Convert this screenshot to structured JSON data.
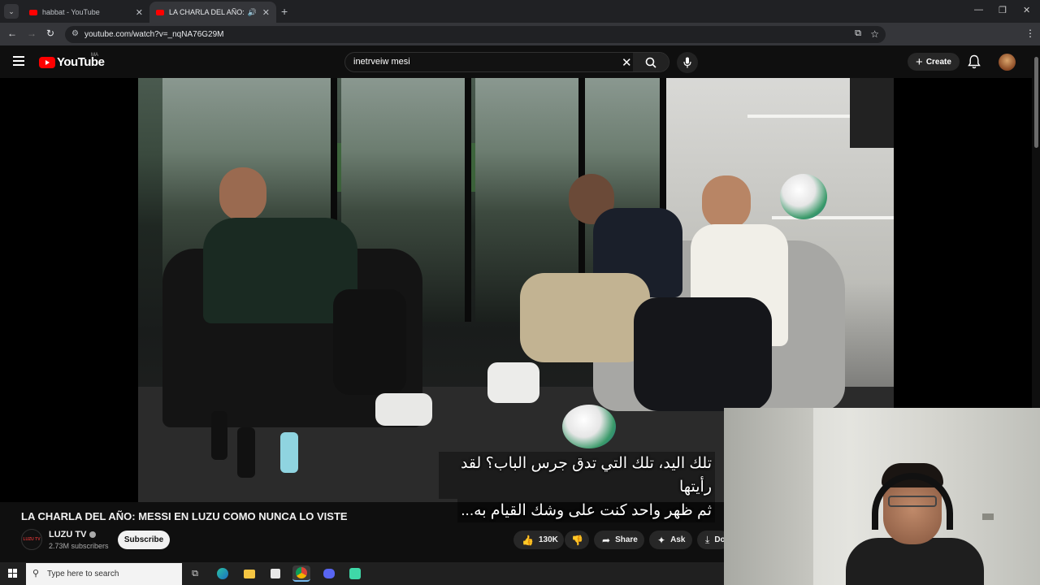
{
  "browser": {
    "tabs": [
      {
        "label": "habbat - YouTube"
      },
      {
        "label": "LA CHARLA DEL AÑO: MES"
      }
    ],
    "url": "youtube.com/watch?v=_nqNA76G29M"
  },
  "youtube": {
    "logo_text": "YouTube",
    "country_code": "MA",
    "search_value": "inetrveiw mesi",
    "create_label": "Create"
  },
  "video": {
    "subtitle_lines": [
      "تلك اليد، تلك التي تدق جرس الباب؟ لقد رأيتها",
      "ثم ظهر واحد كنت على وشك القيام به..."
    ],
    "title": "LA CHARLA DEL AÑO: MESSI EN LUZU COMO NUNCA LO VISTE"
  },
  "channel": {
    "logo_text": "LUZU TV",
    "name": "LUZU TV",
    "subscribers": "2.73M subscribers",
    "subscribe_label": "Subscribe"
  },
  "actions": {
    "likes": "130K",
    "share": "Share",
    "ask": "Ask",
    "download": "Do"
  },
  "taskbar": {
    "search_placeholder": "Type here to search"
  },
  "colors": {
    "youtube_red": "#ff0000",
    "background": "#0f0f0f",
    "chrome_tab": "#35363a"
  }
}
